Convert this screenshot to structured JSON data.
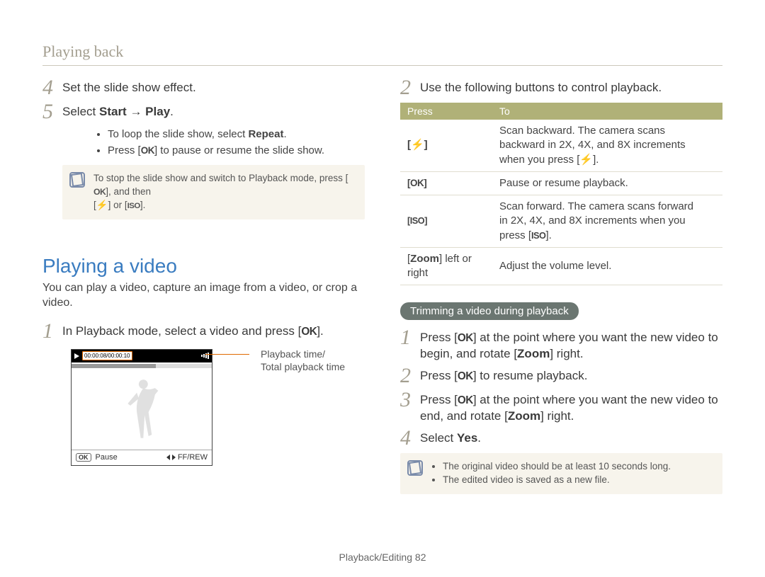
{
  "breadcrumb": "Playing back",
  "left": {
    "step4": {
      "n": "4",
      "text": "Set the slide show effect."
    },
    "step5": {
      "n": "5",
      "prefix": "Select ",
      "bold1": "Start",
      "arrow": " → ",
      "bold2": "Play",
      "suffix": "."
    },
    "bullets5": {
      "b1_pre": "To loop the slide show, select ",
      "b1_bold": "Repeat",
      "b1_suf": ".",
      "b2_pre": "Press [",
      "b2_icon": "OK",
      "b2_suf": "] to pause or resume the slide show."
    },
    "note": {
      "line1_pre": "To stop the slide show and switch to Playback mode, press [",
      "line1_icon": "OK",
      "line1_suf": "], and then",
      "line2_pre": "[",
      "line2_icon1": "⚡",
      "line2_mid": "] or [",
      "line2_icon2": "ISO",
      "line2_suf": "]."
    },
    "heading": "Playing a video",
    "intro": "You can play a video, capture an image from a video, or crop a video.",
    "step1": {
      "n": "1",
      "pre": "In Playback mode, select a video and press [",
      "icon": "OK",
      "suf": "]."
    },
    "video": {
      "timecode": "00:00:08/00:00:10",
      "pause_label": "Pause",
      "ffrew_label": "FF/REW",
      "callout_l1": "Playback time/",
      "callout_l2": "Total playback time"
    }
  },
  "right": {
    "step2": {
      "n": "2",
      "text": "Use the following buttons to control playback."
    },
    "table": {
      "h1": "Press",
      "h2": "To",
      "r1": {
        "press": "[⚡]",
        "to_l1": "Scan backward. The camera scans",
        "to_l2": "backward in 2X, 4X, and 8X increments",
        "to_l3_pre": "when you press [",
        "to_l3_icon": "⚡",
        "to_l3_suf": "]."
      },
      "r2": {
        "press": "[OK]",
        "to": "Pause or resume playback."
      },
      "r3": {
        "press": "[ISO]",
        "to_l1": "Scan forward. The camera scans forward",
        "to_l2": "in 2X, 4X, and 8X increments when you",
        "to_l3_pre": "press [",
        "to_l3_icon": "ISO",
        "to_l3_suf": "]."
      },
      "r4": {
        "press_pre": "[",
        "press_bold": "Zoom",
        "press_suf": "] left or right",
        "to": "Adjust the volume level."
      }
    },
    "pill": "Trimming a video during playback",
    "trim": {
      "s1": {
        "n": "1",
        "pre": "Press [",
        "icon": "OK",
        "mid": "] at the point where you want the new video to begin, and rotate [",
        "bold": "Zoom",
        "suf": "] right."
      },
      "s2": {
        "n": "2",
        "pre": "Press [",
        "icon": "OK",
        "suf": "] to resume playback."
      },
      "s3": {
        "n": "3",
        "pre": "Press [",
        "icon": "OK",
        "mid": "] at the point where you want the new video to end, and rotate [",
        "bold": "Zoom",
        "suf": "] right."
      },
      "s4": {
        "n": "4",
        "pre": "Select ",
        "bold": "Yes",
        "suf": "."
      }
    },
    "note2": {
      "b1": "The original video should be at least 10 seconds long.",
      "b2": "The edited video is saved as a new file."
    }
  },
  "footer": {
    "section": "Playback/Editing ",
    "page": "82"
  }
}
